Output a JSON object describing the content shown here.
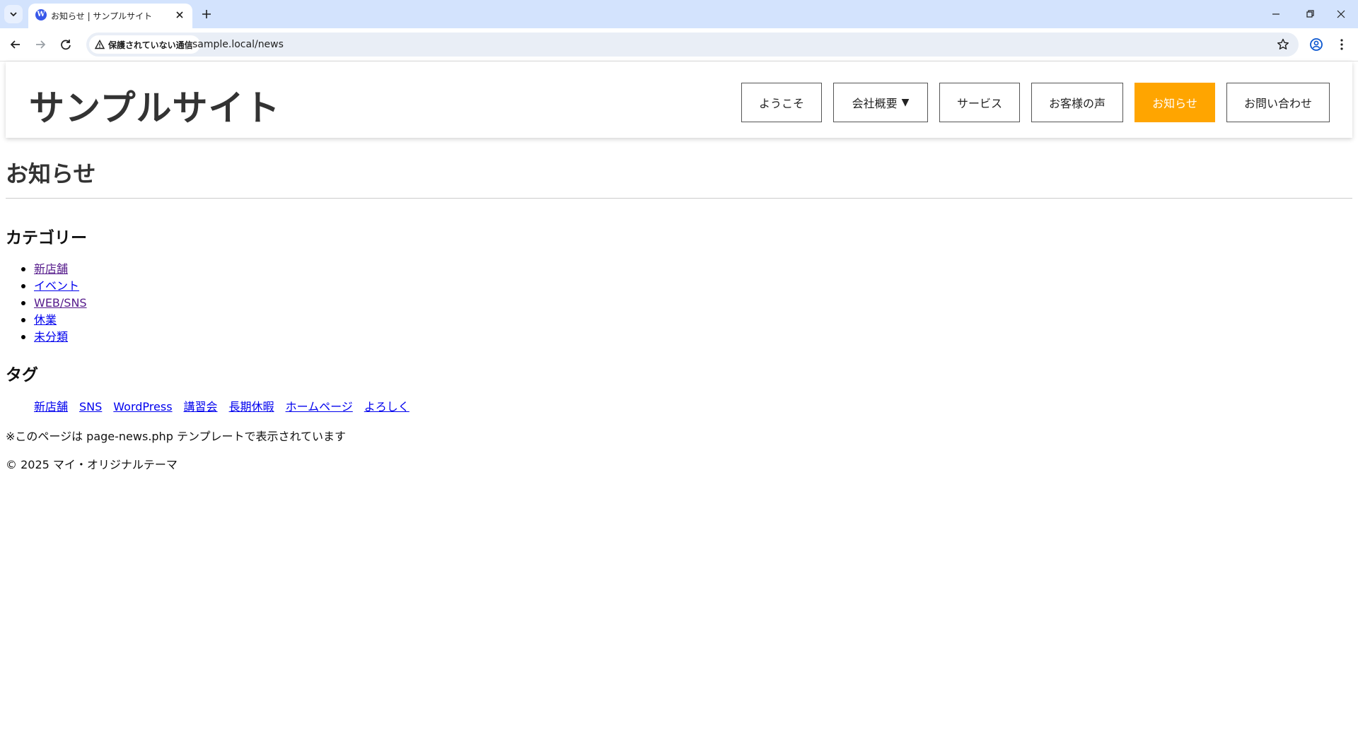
{
  "browser": {
    "tab_title": "お知らせ | サンプルサイト",
    "security_label": "保護されていない通信",
    "url": "sample.local/news"
  },
  "icons": {
    "tab_list": "chevron-down-icon",
    "favicon": "wordpress-icon",
    "tab_close": "close-icon",
    "new_tab": "plus-icon",
    "back": "arrow-left-icon",
    "forward": "arrow-right-icon",
    "reload": "reload-icon",
    "warning": "warning-icon",
    "bookmark": "star-icon",
    "profile": "profile-icon",
    "menu": "kebab-menu-icon"
  },
  "site": {
    "title": "サンプルサイト",
    "nav": [
      {
        "label": "ようこそ"
      },
      {
        "label": "会社概要",
        "caret": "▼"
      },
      {
        "label": "サービス"
      },
      {
        "label": "お客様の声"
      },
      {
        "label": "お知らせ",
        "active": true
      },
      {
        "label": "お問い合わせ"
      }
    ]
  },
  "page": {
    "title": "お知らせ",
    "categories_heading": "カテゴリー",
    "categories": [
      "新店舗",
      "イベント",
      "WEB/SNS",
      "休業",
      "未分類"
    ],
    "tags_heading": "タグ",
    "tags": [
      "新店舗",
      "SNS",
      "WordPress",
      "講習会",
      "長期休暇",
      "ホームページ",
      "よろしく"
    ],
    "template_note": "※このページは page-news.php テンプレートで表示されています",
    "footer": "© 2025 マイ・オリジナルテーマ"
  },
  "colors": {
    "tabbar_bg": "#d3e3fd",
    "active_nav_bg": "#ffa500",
    "link": "#0000ee",
    "visited_link": "#551a8b"
  }
}
